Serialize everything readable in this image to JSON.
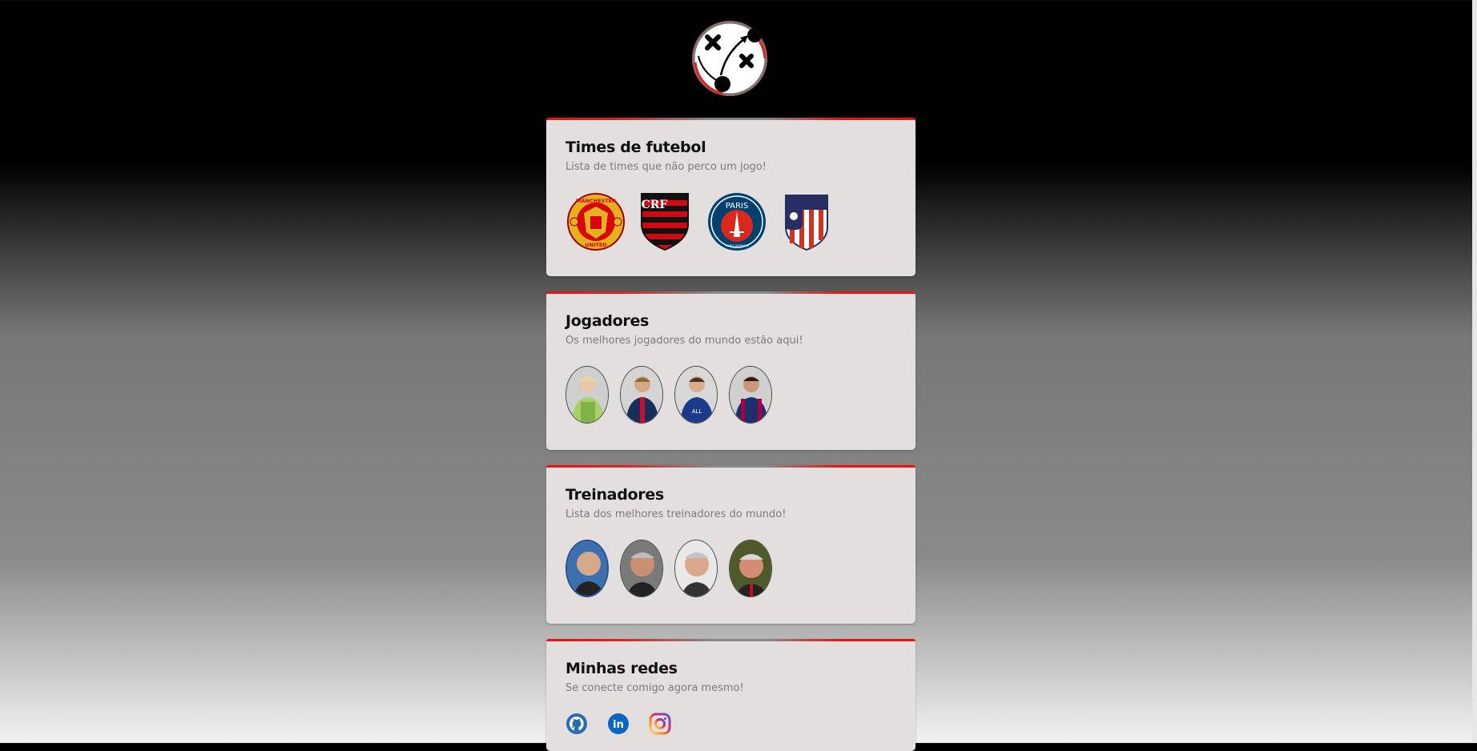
{
  "logo": {
    "icon": "tactics-board-icon"
  },
  "cards": {
    "teams": {
      "title": "Times de futebol",
      "subtitle": "Lista de times que não perco um jogo!",
      "items": [
        "manchester-united-crest",
        "flamengo-crest",
        "psg-crest",
        "atletico-madrid-crest"
      ]
    },
    "players": {
      "title": "Jogadores",
      "subtitle": "Os melhores jogadores do mundo estão aqui!",
      "items": [
        "player-photo-1",
        "player-photo-2",
        "player-photo-3",
        "player-photo-4"
      ]
    },
    "coaches": {
      "title": "Treinadores",
      "subtitle": "Lista dos melhores treinadores do mundo!",
      "items": [
        "coach-photo-1",
        "coach-photo-2",
        "coach-photo-3",
        "coach-photo-4"
      ]
    },
    "social": {
      "title": "Minhas redes",
      "subtitle": "Se conecte comigo agora mesmo!",
      "items": [
        "github-icon",
        "linkedin-icon",
        "instagram-icon"
      ]
    }
  },
  "colors": {
    "accent": "#e11111",
    "card": "#e3dfdf"
  },
  "brand": {
    "man_utd": {
      "top": "MANCHESTER",
      "bottom": "UNITED"
    },
    "flamengo": "CRF",
    "psg": {
      "top": "PARIS",
      "bottom": "SAINT-GERMAIN"
    },
    "linkedin": "in"
  }
}
